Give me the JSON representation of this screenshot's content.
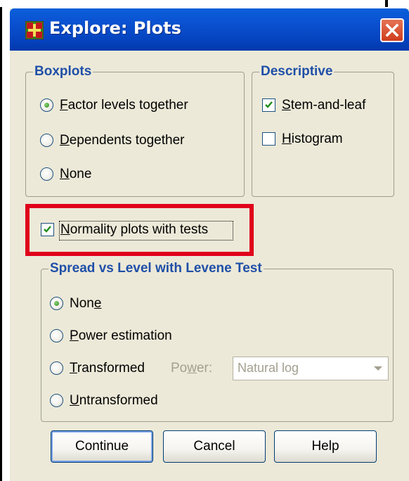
{
  "window": {
    "title": "Explore: Plots",
    "close_icon": "close-icon"
  },
  "boxplots": {
    "legend": "Boxplots",
    "options": [
      {
        "pre": "",
        "key": "F",
        "post": "actor levels together",
        "selected": true
      },
      {
        "pre": "",
        "key": "D",
        "post": "ependents together",
        "selected": false
      },
      {
        "pre": "",
        "key": "N",
        "post": "one",
        "selected": false
      }
    ]
  },
  "descriptive": {
    "legend": "Descriptive",
    "options": [
      {
        "pre": "",
        "key": "S",
        "post": "tem-and-leaf",
        "checked": true
      },
      {
        "pre": "",
        "key": "H",
        "post": "istogram",
        "checked": false
      }
    ]
  },
  "normality": {
    "pre": "",
    "key": "N",
    "post": "ormality plots with tests",
    "checked": true
  },
  "spread": {
    "legend": "Spread vs Level with Levene Test",
    "options": [
      {
        "pre": "Non",
        "key": "e",
        "post": "",
        "selected": true
      },
      {
        "pre": "",
        "key": "P",
        "post": "ower estimation",
        "selected": false
      },
      {
        "pre": "",
        "key": "T",
        "post": "ransformed",
        "selected": false
      },
      {
        "pre": "",
        "key": "U",
        "post": "ntransformed",
        "selected": false
      }
    ],
    "power_label": {
      "pre": "Po",
      "key": "w",
      "post": "er:"
    },
    "power_value": "Natural log"
  },
  "buttons": {
    "continue": "Continue",
    "cancel": "Cancel",
    "help": "Help"
  },
  "colors": {
    "accent": "#1f4fa8",
    "titlebar": "#0b55d4",
    "highlight": "#e0001b"
  }
}
